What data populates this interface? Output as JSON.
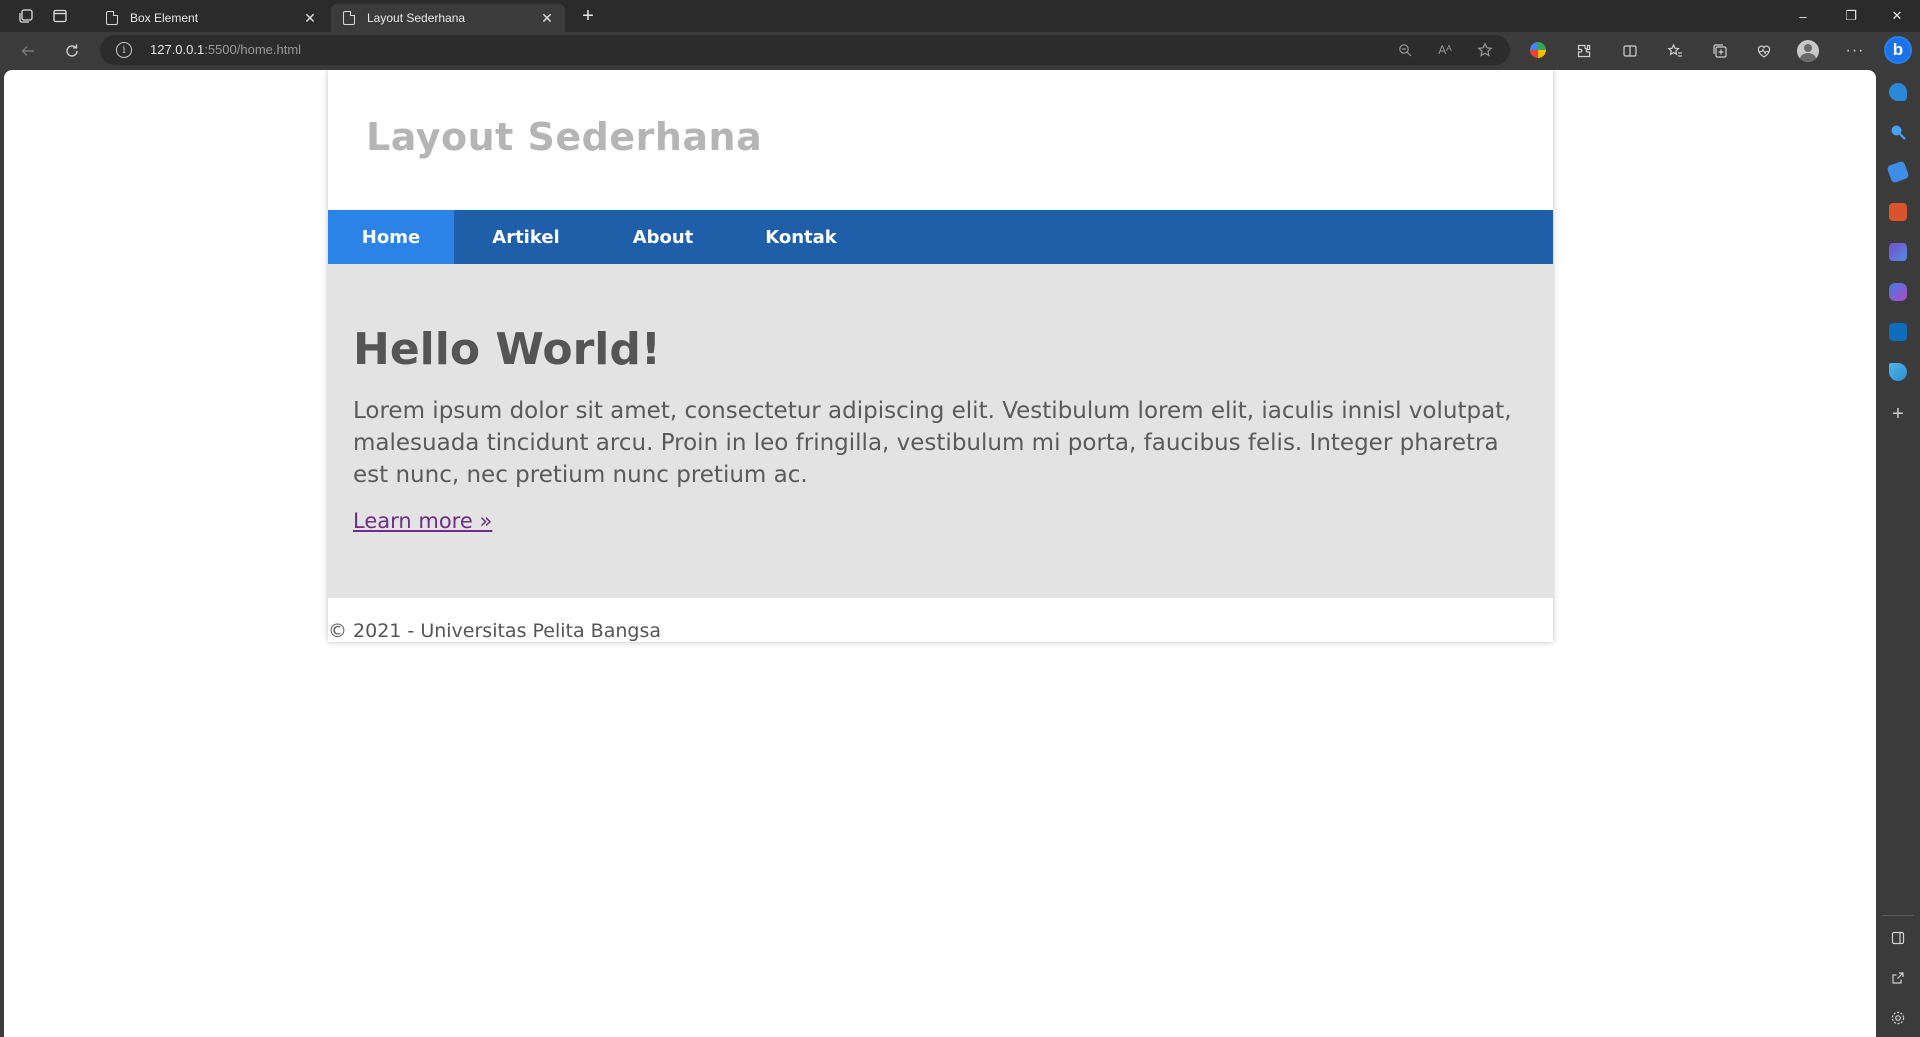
{
  "browser": {
    "tabs": [
      {
        "label": "Box Element",
        "active": false
      },
      {
        "label": "Layout Sederhana",
        "active": true
      }
    ],
    "new_tab_symbol": "+",
    "address": {
      "host": "127.0.0.1",
      "path": ":5500/home.html"
    },
    "window_controls": {
      "minimize": "–",
      "restore": "❐",
      "close": "✕"
    },
    "toolbar_icons": [
      "back-icon",
      "refresh-icon",
      "site-info-icon",
      "zoom-icon",
      "read-aloud-icon",
      "favorite-star-icon",
      "extension-icon",
      "extensions-puzzle-icon",
      "split-screen-icon",
      "favorites-icon",
      "collections-icon",
      "performance-icon",
      "profile-avatar",
      "more-icon"
    ],
    "more_symbol": "···",
    "read_aloud_label": "Aᴬ",
    "bing_label": "b",
    "accent_color": "#1a73e8"
  },
  "sidebar": {
    "icons": [
      "notifications-icon",
      "search-icon",
      "shopping-icon",
      "tools-icon",
      "games-icon",
      "copilot-icon",
      "outlook-icon",
      "telegram-icon"
    ],
    "add_symbol": "+",
    "bottom_icons": [
      "sidebar-toggle-icon",
      "external-link-icon",
      "settings-icon"
    ]
  },
  "page": {
    "site_title": "Layout Sederhana",
    "nav": [
      {
        "label": "Home",
        "active": true
      },
      {
        "label": "Artikel",
        "active": false
      },
      {
        "label": "About",
        "active": false
      },
      {
        "label": "Kontak",
        "active": false
      }
    ],
    "hero": {
      "heading": "Hello World!",
      "body": "Lorem ipsum dolor sit amet, consectetur adipiscing elit. Vestibulum lorem elit, iaculis innisl volutpat, malesuada tincidunt arcu. Proin in leo fringilla, vestibulum mi porta, faucibus felis. Integer pharetra est nunc, nec pretium nunc pretium ac.",
      "link": "Learn more »"
    },
    "footer": "© 2021 - Universitas Pelita Bangsa",
    "colors": {
      "nav_bg": "#1f5faa",
      "nav_active": "#2b83e6",
      "hero_bg": "#e3e3e3",
      "title_color": "#b5b5b5",
      "link_color": "#6b2f86"
    }
  }
}
